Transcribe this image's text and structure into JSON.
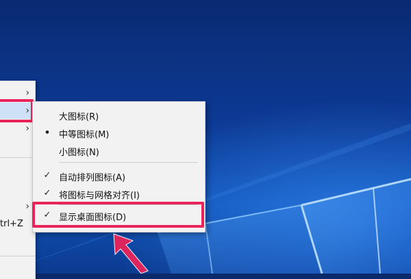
{
  "parent_menu": {
    "items": [
      {
        "has_arrow": true
      },
      {
        "has_arrow": true,
        "active": true
      },
      {
        "has_arrow": true
      },
      {
        "has_arrow": true
      },
      {
        "shortcut": "trl+Z"
      }
    ]
  },
  "submenu": {
    "items": [
      {
        "label": "大图标(R)",
        "mark": ""
      },
      {
        "label": "中等图标(M)",
        "mark": "•"
      },
      {
        "label": "小图标(N)",
        "mark": ""
      },
      {
        "label": "自动排列图标(A)",
        "mark": "✓"
      },
      {
        "label": "将图标与网格对齐(I)",
        "mark": "✓"
      },
      {
        "label": "显示桌面图标(D)",
        "mark": "✓"
      }
    ]
  },
  "annotation": {
    "highlight_color": "#e8245a"
  },
  "icons": {
    "submenu_arrow": "chevron-right-icon",
    "check": "check-icon",
    "bullet": "bullet-icon"
  }
}
